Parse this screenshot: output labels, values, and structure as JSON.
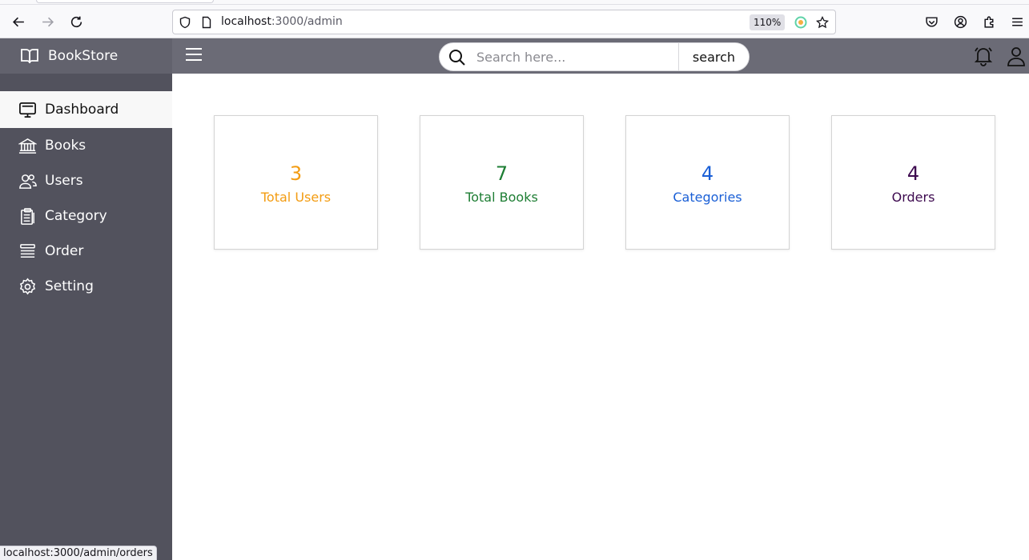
{
  "browser": {
    "url_host": "localhost",
    "url_path": ":3000/admin",
    "zoom": "110%",
    "status_link": "localhost:3000/admin/orders"
  },
  "sidebar": {
    "brand": "BookStore",
    "items": [
      {
        "label": "Dashboard",
        "icon": "monitor-icon",
        "active": true
      },
      {
        "label": "Books",
        "icon": "library-icon",
        "active": false
      },
      {
        "label": "Users",
        "icon": "users-icon",
        "active": false
      },
      {
        "label": "Category",
        "icon": "clipboard-icon",
        "active": false
      },
      {
        "label": "Order",
        "icon": "list-icon",
        "active": false
      },
      {
        "label": "Setting",
        "icon": "gear-icon",
        "active": false
      }
    ]
  },
  "header": {
    "search_placeholder": "Search here...",
    "search_button": "search"
  },
  "stats": [
    {
      "value": "3",
      "label": "Total Users",
      "color": "#f39c12"
    },
    {
      "value": "7",
      "label": "Total Books",
      "color": "#1e7e34"
    },
    {
      "value": "4",
      "label": "Categories",
      "color": "#1a5fd6"
    },
    {
      "value": "4",
      "label": "Orders",
      "color": "#3d0a4f"
    }
  ],
  "colors": {
    "sidebar_bg": "#52525d",
    "header_bg": "#6b6b76",
    "active_item_bg": "#f8f8f8"
  }
}
